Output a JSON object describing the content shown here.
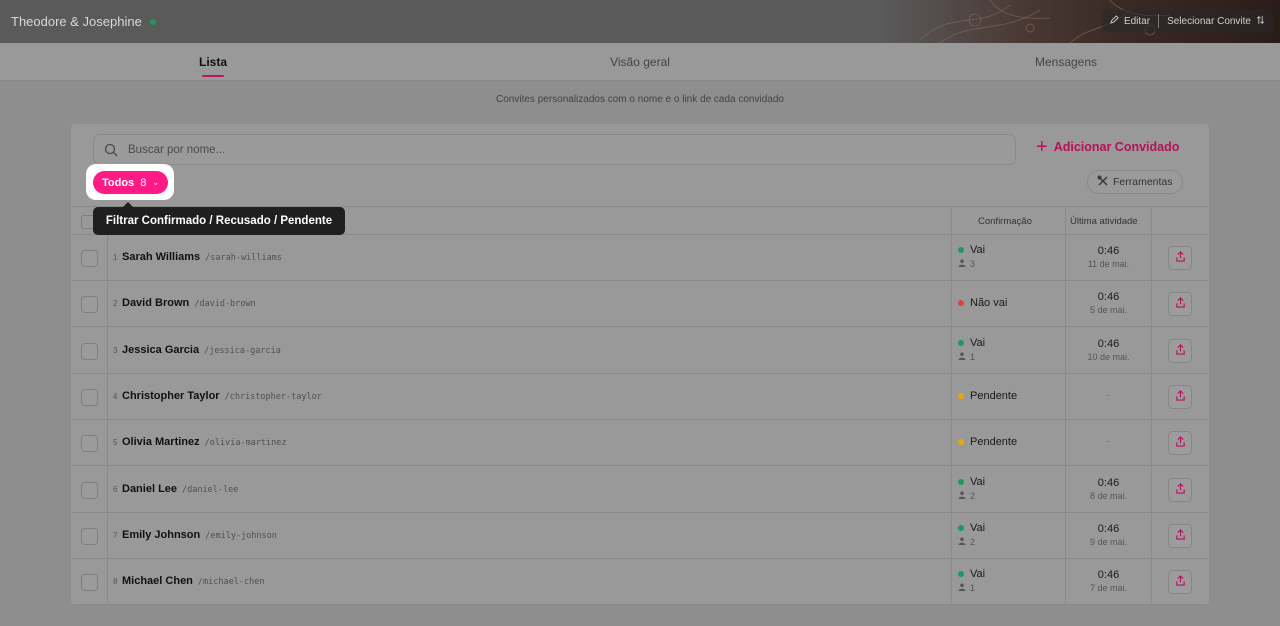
{
  "header": {
    "title": "Theodore & Josephine",
    "edit_label": "Editar",
    "select_label": "Selecionar Convite"
  },
  "tabs": [
    {
      "label": "Lista",
      "active": true
    },
    {
      "label": "Visão geral",
      "active": false
    },
    {
      "label": "Mensagens",
      "active": false
    }
  ],
  "subtitle": "Convites personalizados com o nome e o link de cada convidado",
  "search": {
    "placeholder": "Buscar por nome..."
  },
  "add_guest_label": "Adicionar Convidado",
  "tools_label": "Ferramentas",
  "filter": {
    "label": "Todos",
    "count": "8"
  },
  "tooltip": "Filtrar Confirmado / Recusado / Pendente",
  "columns": {
    "confirmation": "Confirmação",
    "last_activity": "Última atividade"
  },
  "colors": {
    "accent": "#ff1a86",
    "going": "#1a9a5c",
    "not_going": "#e0403a",
    "pending": "#e8a800"
  },
  "guests": [
    {
      "num": "1",
      "name": "Sarah Williams",
      "slug": "/sarah-williams",
      "status": "Vai",
      "status_type": "going",
      "guests": "3",
      "time": "0:46",
      "date": "11 de mai."
    },
    {
      "num": "2",
      "name": "David Brown",
      "slug": "/david-brown",
      "status": "Não vai",
      "status_type": "not_going",
      "guests": "",
      "time": "0:46",
      "date": "5 de mai."
    },
    {
      "num": "3",
      "name": "Jessica Garcia",
      "slug": "/jessica-garcia",
      "status": "Vai",
      "status_type": "going",
      "guests": "1",
      "time": "0:46",
      "date": "10 de mai."
    },
    {
      "num": "4",
      "name": "Christopher Taylor",
      "slug": "/christopher-taylor",
      "status": "Pendente",
      "status_type": "pending",
      "guests": "",
      "time": "",
      "date": "-"
    },
    {
      "num": "5",
      "name": "Olivia Martinez",
      "slug": "/olivia-martinez",
      "status": "Pendente",
      "status_type": "pending",
      "guests": "",
      "time": "",
      "date": "-"
    },
    {
      "num": "6",
      "name": "Daniel Lee",
      "slug": "/daniel-lee",
      "status": "Vai",
      "status_type": "going",
      "guests": "2",
      "time": "0:46",
      "date": "8 de mai."
    },
    {
      "num": "7",
      "name": "Emily Johnson",
      "slug": "/emily-johnson",
      "status": "Vai",
      "status_type": "going",
      "guests": "2",
      "time": "0:46",
      "date": "9 de mai."
    },
    {
      "num": "8",
      "name": "Michael Chen",
      "slug": "/michael-chen",
      "status": "Vai",
      "status_type": "going",
      "guests": "1",
      "time": "0:46",
      "date": "7 de mai."
    }
  ]
}
